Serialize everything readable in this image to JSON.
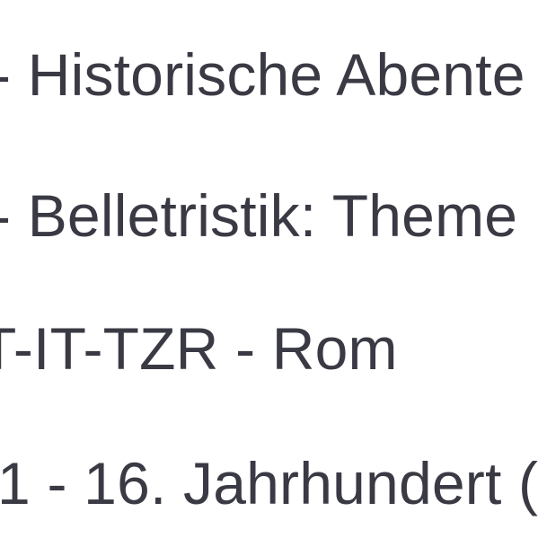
{
  "category_list": {
    "items": [
      {
        "label": "- Historische Abente"
      },
      {
        "label": "- Belletristik: Theme"
      },
      {
        "label": "T-IT-TZR - Rom"
      },
      {
        "label": "1 - 16. Jahrhundert ("
      }
    ]
  },
  "colors": {
    "text": "#3a3a44",
    "background": "#ffffff"
  }
}
